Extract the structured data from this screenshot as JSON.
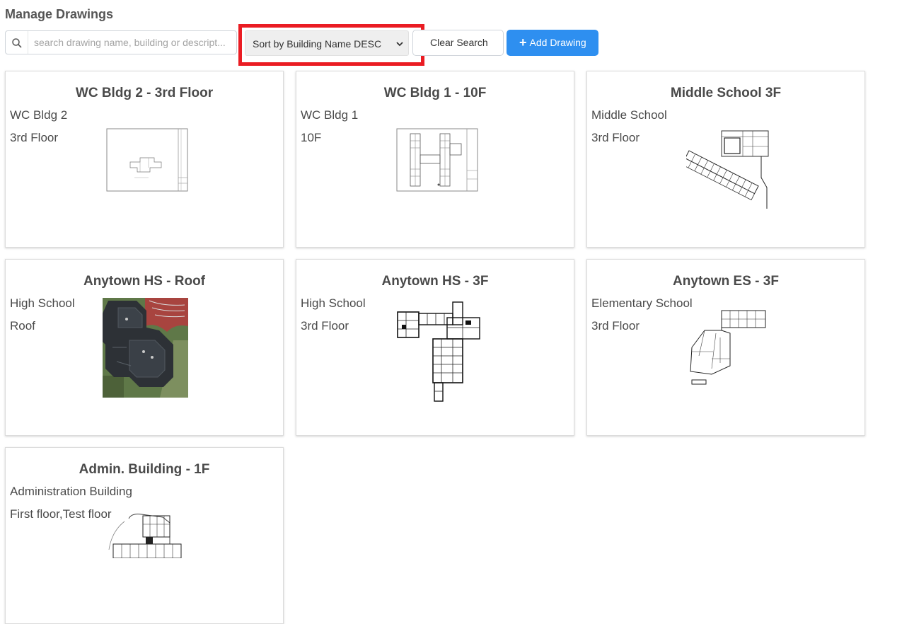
{
  "header": {
    "title": "Manage Drawings"
  },
  "search": {
    "placeholder": "search drawing name, building or descript...",
    "value": ""
  },
  "sort": {
    "selected": "Sort by Building Name DESC"
  },
  "toolbar": {
    "clear_label": "Clear Search",
    "add_label": "Add Drawing",
    "add_icon": "+"
  },
  "colors": {
    "accent": "#2e8ff0",
    "highlight": "#ea1c23"
  },
  "cards": [
    {
      "title": "WC Bldg 2 - 3rd Floor",
      "building": "WC Bldg 2",
      "floor": "3rd Floor",
      "thumbnail": "sheet-plan-sparse"
    },
    {
      "title": "WC Bldg 1 - 10F",
      "building": "WC Bldg 1",
      "floor": "10F",
      "thumbnail": "sheet-plan-h"
    },
    {
      "title": "Middle School 3F",
      "building": "Middle School",
      "floor": "3rd Floor",
      "thumbnail": "angled-plan"
    },
    {
      "title": "Anytown HS - Roof",
      "building": "High School",
      "floor": "Roof",
      "thumbnail": "aerial-photo"
    },
    {
      "title": "Anytown HS - 3F",
      "building": "High School",
      "floor": "3rd Floor",
      "thumbnail": "t-plan"
    },
    {
      "title": "Anytown ES - 3F",
      "building": "Elementary School",
      "floor": "3rd Floor",
      "thumbnail": "l-plan"
    },
    {
      "title": "Admin. Building - 1F",
      "building": "Administration Building",
      "floor": "First floor,Test floor",
      "thumbnail": "curved-plan"
    }
  ]
}
